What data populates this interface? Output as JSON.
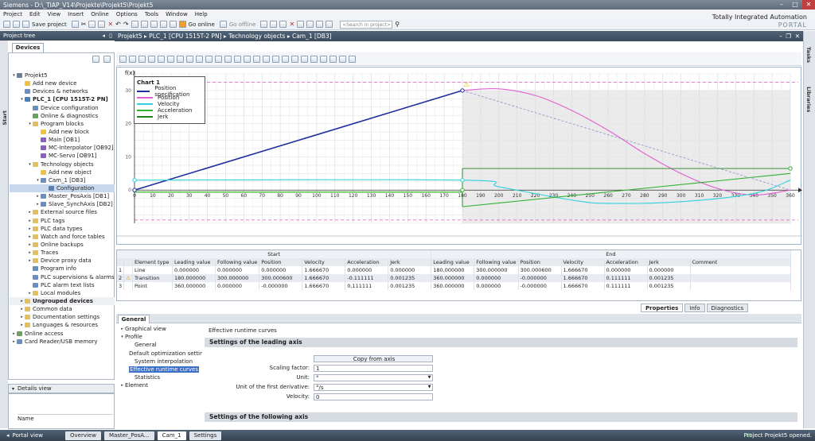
{
  "window": {
    "title": "Siemens  -  D:\\_TIAP_V14\\Projekte\\Projekt5\\Projekt5"
  },
  "menu": [
    "Project",
    "Edit",
    "View",
    "Insert",
    "Online",
    "Options",
    "Tools",
    "Window",
    "Help"
  ],
  "toolbar": {
    "save_label": "Save project",
    "go_online": "Go online",
    "go_offline": "Go offline",
    "search_placeholder": "<Search in project>"
  },
  "branding": {
    "line1": "Totally Integrated Automation",
    "line2": "PORTAL"
  },
  "left": {
    "title": "Project tree",
    "devices_tab": "Devices",
    "details_title": "Details view",
    "name_col": "Name",
    "side_tab": "Start"
  },
  "tree": [
    {
      "label": "Projekt5",
      "indent": 0,
      "tw": "▾",
      "color": "#6b7f99"
    },
    {
      "label": "Add new device",
      "indent": 1,
      "tw": "",
      "color": "#f0c040"
    },
    {
      "label": "Devices & networks",
      "indent": 1,
      "tw": "",
      "color": "#6a8fbf"
    },
    {
      "label": "PLC_1 [CPU 1515T-2 PN]",
      "indent": 1,
      "tw": "▾",
      "color": "#4a7fbf",
      "bold": true
    },
    {
      "label": "Device configuration",
      "indent": 2,
      "tw": "",
      "color": "#6a8fbf"
    },
    {
      "label": "Online & diagnostics",
      "indent": 2,
      "tw": "",
      "color": "#6aa060"
    },
    {
      "label": "Program blocks",
      "indent": 2,
      "tw": "▾",
      "color": "#e0c060"
    },
    {
      "label": "Add new block",
      "indent": 3,
      "tw": "",
      "color": "#f0c040"
    },
    {
      "label": "Main [OB1]",
      "indent": 3,
      "tw": "",
      "color": "#8a5fbf"
    },
    {
      "label": "MC-Interpolator [OB92]",
      "indent": 3,
      "tw": "",
      "color": "#8a5fbf"
    },
    {
      "label": "MC-Servo [OB91]",
      "indent": 3,
      "tw": "",
      "color": "#8a5fbf"
    },
    {
      "label": "Technology objects",
      "indent": 2,
      "tw": "▾",
      "color": "#e0c060"
    },
    {
      "label": "Add new object",
      "indent": 3,
      "tw": "",
      "color": "#f0c040"
    },
    {
      "label": "Cam_1 [DB3]",
      "indent": 3,
      "tw": "▾",
      "color": "#6a8fbf"
    },
    {
      "label": "Configuration",
      "indent": 4,
      "tw": "",
      "color": "#5a7fb0",
      "selected": true
    },
    {
      "label": "Master_PosAxis [DB1]",
      "indent": 3,
      "tw": "▸",
      "color": "#6a8fbf"
    },
    {
      "label": "Slave_SynchAxis [DB2]",
      "indent": 3,
      "tw": "▸",
      "color": "#6a8fbf"
    },
    {
      "label": "External source files",
      "indent": 2,
      "tw": "▸",
      "color": "#e0c060"
    },
    {
      "label": "PLC tags",
      "indent": 2,
      "tw": "▸",
      "color": "#e0c060"
    },
    {
      "label": "PLC data types",
      "indent": 2,
      "tw": "▸",
      "color": "#e0c060"
    },
    {
      "label": "Watch and force tables",
      "indent": 2,
      "tw": "▸",
      "color": "#e0c060"
    },
    {
      "label": "Online backups",
      "indent": 2,
      "tw": "▸",
      "color": "#e0c060"
    },
    {
      "label": "Traces",
      "indent": 2,
      "tw": "▸",
      "color": "#e0c060"
    },
    {
      "label": "Device proxy data",
      "indent": 2,
      "tw": "▸",
      "color": "#e0c060"
    },
    {
      "label": "Program info",
      "indent": 2,
      "tw": "",
      "color": "#6a8fbf"
    },
    {
      "label": "PLC supervisions & alarms",
      "indent": 2,
      "tw": "",
      "color": "#6a8fbf"
    },
    {
      "label": "PLC alarm text lists",
      "indent": 2,
      "tw": "",
      "color": "#6a8fbf"
    },
    {
      "label": "Local modules",
      "indent": 2,
      "tw": "▸",
      "color": "#e0c060"
    },
    {
      "label": "Ungrouped devices",
      "indent": 1,
      "tw": "▸",
      "color": "#e0c060",
      "bold": true,
      "shade": true
    },
    {
      "label": "Common data",
      "indent": 1,
      "tw": "▸",
      "color": "#e0c060"
    },
    {
      "label": "Documentation settings",
      "indent": 1,
      "tw": "▸",
      "color": "#e0c060"
    },
    {
      "label": "Languages & resources",
      "indent": 1,
      "tw": "▸",
      "color": "#e0c060"
    },
    {
      "label": "Online access",
      "indent": 0,
      "tw": "▸",
      "color": "#6aa060"
    },
    {
      "label": "Card Reader/USB memory",
      "indent": 0,
      "tw": "▸",
      "color": "#6a8fbf"
    }
  ],
  "editor": {
    "breadcrumb": "Projekt5  ▸  PLC_1 [CPU 1515T-2 PN]  ▸  Technology objects  ▸  Cam_1 [DB3]"
  },
  "chart_data": {
    "type": "line",
    "title": "Chart 1",
    "ylabel": "f(x)",
    "xlim": [
      0,
      360
    ],
    "ylim": [
      -10,
      35
    ],
    "x_ticks": [
      0,
      10,
      20,
      30,
      40,
      50,
      60,
      70,
      80,
      90,
      100,
      110,
      120,
      130,
      140,
      150,
      160,
      170,
      180,
      190,
      200,
      210,
      220,
      230,
      240,
      250,
      260,
      270,
      280,
      290,
      300,
      310,
      320,
      330,
      340,
      350,
      360
    ],
    "y_ticks": [
      0,
      10,
      20,
      30
    ],
    "legend": [
      "Position specification",
      "Position",
      "Velocity",
      "Acceleration",
      "Jerk"
    ],
    "colors": {
      "position_spec": "#1f2f9f",
      "position": "#e060d0",
      "velocity": "#30d0e0",
      "acceleration": "#30b030",
      "jerk": "#208020"
    },
    "series": [
      {
        "name": "Position specification",
        "x": [
          0,
          180
        ],
        "y": [
          0,
          30
        ]
      },
      {
        "name": "Position",
        "x": [
          180,
          200,
          220,
          240,
          260,
          280,
          300,
          320,
          340,
          360
        ],
        "y": [
          30,
          30.5,
          28.5,
          24,
          18,
          11,
          5,
          0.5,
          -1.5,
          0
        ]
      },
      {
        "name": "Velocity",
        "x": [
          0,
          180,
          200,
          240,
          260,
          300,
          340,
          360
        ],
        "y": [
          3,
          3,
          1,
          -3,
          -4,
          -3.5,
          -1,
          3
        ]
      },
      {
        "name": "Acceleration",
        "x": [
          180,
          360
        ],
        "y": [
          -5,
          5
        ]
      }
    ]
  },
  "table": {
    "group_start": "Start",
    "group_end": "End",
    "headers": [
      "",
      "",
      "Element type",
      "Leading value",
      "Following value",
      "Position",
      "Velocity",
      "Acceleration",
      "Jerk",
      "Leading value",
      "Following value",
      "Position",
      "Velocity",
      "Acceleration",
      "Jerk",
      "Comment"
    ],
    "rows": [
      [
        "1",
        "",
        "Line",
        "0.000000",
        "0.000000",
        "0.000000",
        "1.666670",
        "0.000000",
        "0.000000",
        "180.000000",
        "300.000000",
        "300.000600",
        "1.666670",
        "0.000000",
        "0.000000",
        ""
      ],
      [
        "2",
        "⚠",
        "Transition",
        "180.000000",
        "300.000000",
        "300.000600",
        "1.666670",
        "-0.111111",
        "0.001235",
        "360.000000",
        "0.000000",
        "-0.000000",
        "1.666670",
        "0.111111",
        "0.001235",
        ""
      ],
      [
        "3",
        "",
        "Point",
        "360.000000",
        "0.000000",
        "-0.000000",
        "1.666670",
        "0.111111",
        "0.001235",
        "360.000000",
        "0.000000",
        "-0.000000",
        "1.666670",
        "0.111111",
        "0.001235",
        ""
      ]
    ]
  },
  "props": {
    "tab_properties": "Properties",
    "tab_info": "Info",
    "tab_diag": "Diagnostics",
    "general_tab": "General"
  },
  "nav": [
    {
      "label": "Graphical view",
      "indent": 0,
      "tw": "▸"
    },
    {
      "label": "Profile",
      "indent": 0,
      "tw": "▾"
    },
    {
      "label": "General",
      "indent": 1,
      "tw": ""
    },
    {
      "label": "Default optimization settings",
      "indent": 1,
      "tw": ""
    },
    {
      "label": "System interpolation",
      "indent": 1,
      "tw": ""
    },
    {
      "label": "Effective runtime curves",
      "indent": 1,
      "tw": "",
      "selected": true
    },
    {
      "label": "Statistics",
      "indent": 1,
      "tw": ""
    },
    {
      "label": "Element",
      "indent": 0,
      "tw": "▸"
    }
  ],
  "content": {
    "title": "Effective runtime curves",
    "sec1": "Settings of the leading axis",
    "copy_btn": "Copy from axis",
    "scaling_label": "Scaling factor:",
    "scaling_value": "1",
    "unit_label": "Unit:",
    "unit_value": "°",
    "deriv_label": "Unit of the first derivative:",
    "deriv_value": "°/s",
    "velocity_label": "Velocity:",
    "velocity_value": "0",
    "sec2": "Settings of the following axis"
  },
  "statusbar": {
    "portal": "Portal view",
    "tabs": [
      "Overview",
      "Master_PosA...",
      "Cam_1",
      "Settings"
    ],
    "message": "Project Projekt5 opened."
  },
  "right_tabs": [
    "Tasks",
    "Libraries"
  ]
}
